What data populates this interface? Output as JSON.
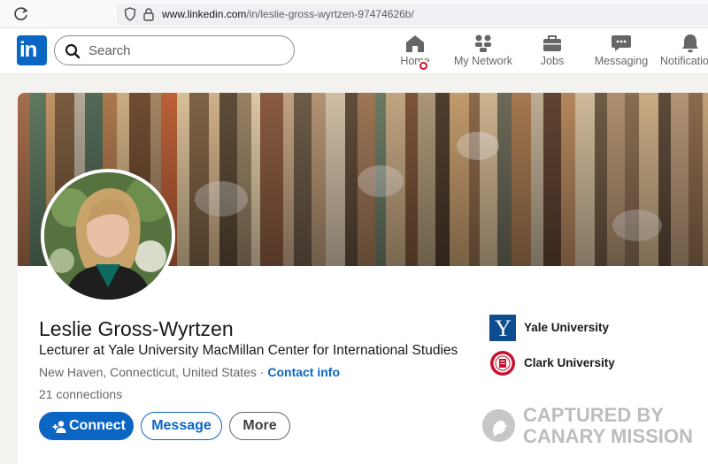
{
  "browser": {
    "url_host": "www.linkedin.com",
    "url_path": "/in/leslie-gross-wyrtzen-97474626b/"
  },
  "nav": {
    "logo": "in",
    "search_placeholder": "Search",
    "items": [
      {
        "label": "Home",
        "icon": "home-icon"
      },
      {
        "label": "My Network",
        "icon": "network-icon"
      },
      {
        "label": "Jobs",
        "icon": "briefcase-icon"
      },
      {
        "label": "Messaging",
        "icon": "messaging-icon"
      },
      {
        "label": "Notifications",
        "icon": "bell-icon"
      }
    ]
  },
  "profile": {
    "name": "Leslie Gross-Wyrtzen",
    "headline": "Lecturer at Yale University MacMillan Center for International Studies",
    "location": "New Haven, Connecticut, United States",
    "separator": " · ",
    "contact_link": "Contact info",
    "connections": "21 connections",
    "buttons": {
      "connect": "Connect",
      "message": "Message",
      "more": "More"
    },
    "education": [
      {
        "name": "Yale University",
        "logo_letter": "Y"
      },
      {
        "name": "Clark University"
      }
    ]
  },
  "watermark": {
    "line1": "CAPTURED BY",
    "line2": "CANARY MISSION"
  },
  "colors": {
    "linkedin_blue": "#0a66c2",
    "yale_blue": "#0f4d92",
    "clark_red": "#c8102e",
    "notification_red": "#cb112d"
  }
}
